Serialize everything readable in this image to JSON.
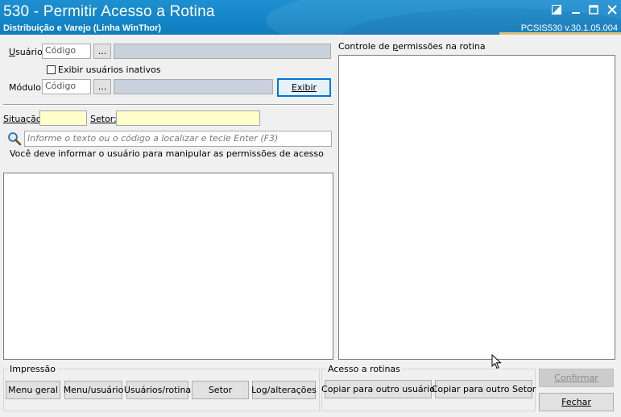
{
  "window": {
    "title": "530 - Permitir Acesso a Rotina",
    "subtitle": "Distribuição e Varejo (Linha WinThor)",
    "version": "PCSIS530  v.30.1.05.004"
  },
  "usuario": {
    "label": "Usuário:",
    "codigo_value": "Código",
    "lookup_label": "...",
    "show_inactive_label": "Exibir usuários inativos"
  },
  "modulo": {
    "label": "Módulo:",
    "codigo_value": "Código",
    "lookup_label": "...",
    "exibir_label": "Exibir"
  },
  "filters": {
    "situacao_label": "Situação:",
    "setor_label": "Setor:"
  },
  "search": {
    "placeholder": "Informe o texto ou o código a localizar e tecle Enter (F3)",
    "hint": "Você deve informar o usuário para manipular as permissões de acesso"
  },
  "permissions": {
    "title": "Controle de permissões na rotina"
  },
  "impressao": {
    "legend": "Impressão",
    "buttons": [
      "Menu geral",
      "Menu/usuário",
      "Usuários/rotina",
      "Setor",
      "Log/alterações"
    ]
  },
  "acesso": {
    "legend": "Acesso a rotinas",
    "copy_user_label": "Copiar para outro usuário",
    "copy_setor_label": "Copiar para outro Setor"
  },
  "actions": {
    "confirmar_label": "Confirmar",
    "fechar_label": "Fechar"
  },
  "colors": {
    "titlebar": "#1486c8",
    "required_field": "#ffffcc",
    "readonly_field": "#c9d1dc",
    "focus_border": "#0078d7"
  }
}
